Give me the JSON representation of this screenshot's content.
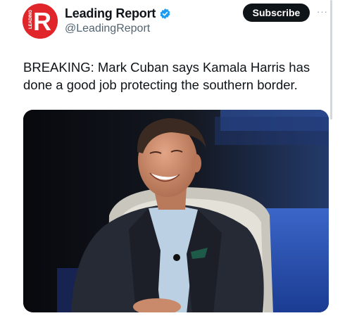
{
  "author": {
    "avatar_letter": "R",
    "avatar_text": "LEADING",
    "display_name": "Leading Report",
    "handle": "@LeadingReport",
    "verified": true
  },
  "actions": {
    "subscribe_label": "Subscribe",
    "more_label": "···"
  },
  "tweet": {
    "text": "BREAKING: Mark Cuban says Kamala Harris has\ndone a good job protecting the southern border."
  },
  "media": {
    "kind": "photo"
  },
  "colors": {
    "brand_red": "#e0262a",
    "verified_blue": "#1d9bf0",
    "text_primary": "#0f1419",
    "text_secondary": "#536471"
  }
}
